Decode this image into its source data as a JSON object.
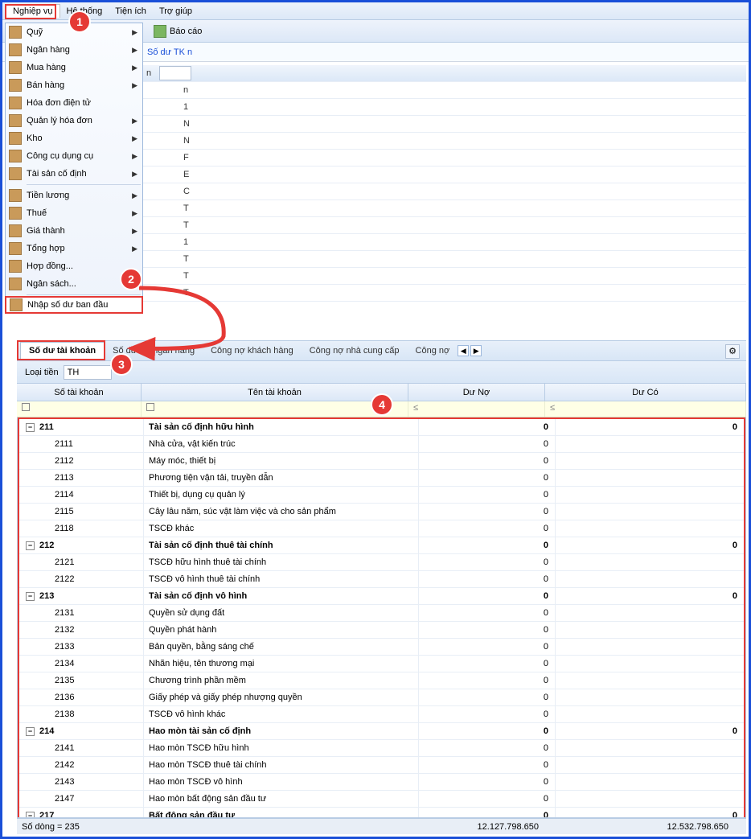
{
  "menubar": [
    "Nghiệp vụ",
    "Hệ thống",
    "Tiện ích",
    "Trợ giúp"
  ],
  "toolbar": {
    "bao_cao": "Báo cáo"
  },
  "linkbar": {
    "so_du_tk": "Số dư TK n"
  },
  "dropdown": {
    "items": [
      {
        "label": "Quỹ",
        "arrow": true
      },
      {
        "label": "Ngân hàng",
        "arrow": true
      },
      {
        "label": "Mua hàng",
        "arrow": true
      },
      {
        "label": "Bán hàng",
        "arrow": true
      },
      {
        "label": "Hóa đơn điện tử",
        "arrow": false
      },
      {
        "label": "Quản lý hóa đơn",
        "arrow": true
      },
      {
        "label": "Kho",
        "arrow": true
      },
      {
        "label": "Công cụ dụng cụ",
        "arrow": true
      },
      {
        "label": "Tài sản cố định",
        "arrow": true
      },
      {
        "sep": true
      },
      {
        "label": "Tiền lương",
        "arrow": true
      },
      {
        "label": "Thuế",
        "arrow": true
      },
      {
        "label": "Giá thành",
        "arrow": true
      },
      {
        "label": "Tổng hợp",
        "arrow": true
      },
      {
        "label": "Hợp đồng...",
        "arrow": false
      },
      {
        "label": "Ngân sách...",
        "arrow": false
      },
      {
        "sep": true
      },
      {
        "label": "Nhập số dư ban đầu",
        "arrow": false,
        "highlight": true
      }
    ]
  },
  "bg_sample": [
    "n",
    "1",
    "N",
    "N",
    "F",
    "E",
    "C",
    "T",
    "T",
    "1",
    "T",
    "T",
    "T"
  ],
  "tabs": {
    "items": [
      "Số dư tài khoản",
      "Số dư TK ngân hàng",
      "Công nợ khách hàng",
      "Công nợ nhà cung cấp",
      "Công nợ"
    ],
    "active": 0
  },
  "filter": {
    "label": "Loại tiền",
    "value": "TH"
  },
  "grid_head": [
    "Số tài khoản",
    "Tên tài khoản",
    "Dư Nợ",
    "Dư Có"
  ],
  "filter_sym": "≤",
  "rows": [
    {
      "p": true,
      "code": "211",
      "name": "Tài sản cố định hữu hình",
      "no": "0",
      "co": "0"
    },
    {
      "code": "2111",
      "name": "Nhà cửa, vật kiến trúc",
      "no": "0",
      "co": ""
    },
    {
      "code": "2112",
      "name": "Máy móc, thiết bị",
      "no": "0",
      "co": ""
    },
    {
      "code": "2113",
      "name": "Phương tiện vận tải, truyền dẫn",
      "no": "0",
      "co": ""
    },
    {
      "code": "2114",
      "name": "Thiết bị, dụng cụ quản lý",
      "no": "0",
      "co": ""
    },
    {
      "code": "2115",
      "name": "Cây lâu năm, súc vật làm việc và cho sản phẩm",
      "no": "0",
      "co": ""
    },
    {
      "code": "2118",
      "name": "TSCĐ khác",
      "no": "0",
      "co": ""
    },
    {
      "p": true,
      "code": "212",
      "name": "Tài sản cố định thuê tài chính",
      "no": "0",
      "co": "0"
    },
    {
      "code": "2121",
      "name": "TSCĐ hữu hình thuê tài chính",
      "no": "0",
      "co": ""
    },
    {
      "code": "2122",
      "name": "TSCĐ vô hình thuê tài chính",
      "no": "0",
      "co": ""
    },
    {
      "p": true,
      "code": "213",
      "name": "Tài sản cố định vô hình",
      "no": "0",
      "co": "0"
    },
    {
      "code": "2131",
      "name": "Quyền sử dụng đất",
      "no": "0",
      "co": ""
    },
    {
      "code": "2132",
      "name": "Quyền phát hành",
      "no": "0",
      "co": ""
    },
    {
      "code": "2133",
      "name": "Bản quyền, bằng sáng chế",
      "no": "0",
      "co": ""
    },
    {
      "code": "2134",
      "name": "Nhãn hiệu, tên thương mại",
      "no": "0",
      "co": ""
    },
    {
      "code": "2135",
      "name": "Chương trình phần mềm",
      "no": "0",
      "co": ""
    },
    {
      "code": "2136",
      "name": "Giấy phép và giấy phép nhượng quyền",
      "no": "0",
      "co": ""
    },
    {
      "code": "2138",
      "name": "TSCĐ vô hình khác",
      "no": "0",
      "co": ""
    },
    {
      "p": true,
      "code": "214",
      "name": "Hao mòn tài sản cố định",
      "no": "0",
      "co": "0"
    },
    {
      "code": "2141",
      "name": "Hao mòn TSCĐ hữu hình",
      "no": "0",
      "co": ""
    },
    {
      "code": "2142",
      "name": "Hao mòn TSCĐ thuê tài chính",
      "no": "0",
      "co": ""
    },
    {
      "code": "2143",
      "name": "Hao mòn TSCĐ vô hình",
      "no": "0",
      "co": ""
    },
    {
      "code": "2147",
      "name": "Hao mòn bất động sản đầu tư",
      "no": "0",
      "co": ""
    },
    {
      "p": true,
      "code": "217",
      "name": "Bất động sản đầu tư",
      "no": "0",
      "co": "0"
    }
  ],
  "footer": {
    "count": "Số dòng = 235",
    "total_no": "12.127.798.650",
    "total_co": "12.532.798.650"
  }
}
